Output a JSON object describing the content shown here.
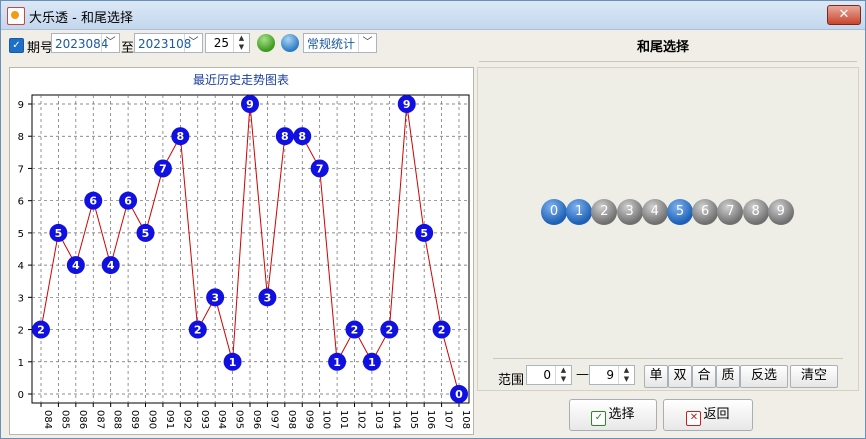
{
  "window": {
    "title": "大乐透 - 和尾选择",
    "close": "✕"
  },
  "toolbar": {
    "period_label": "期号",
    "from": "2023084",
    "to_label": "至",
    "to": "2023108",
    "count": "25",
    "stat_mode": "常规统计"
  },
  "right_panel": {
    "title": "和尾选择",
    "balls": [
      {
        "label": "0",
        "selected": true
      },
      {
        "label": "1",
        "selected": true
      },
      {
        "label": "2",
        "selected": false
      },
      {
        "label": "3",
        "selected": false
      },
      {
        "label": "4",
        "selected": false
      },
      {
        "label": "5",
        "selected": true
      },
      {
        "label": "6",
        "selected": false
      },
      {
        "label": "7",
        "selected": false
      },
      {
        "label": "8",
        "selected": false
      },
      {
        "label": "9",
        "selected": false
      }
    ],
    "range_label": "范围",
    "range_min": "0",
    "range_dash": "—",
    "range_max": "9",
    "filters": [
      "单",
      "双",
      "合",
      "质",
      "反选",
      "清空"
    ]
  },
  "actions": {
    "select": "选择",
    "back": "返回"
  },
  "chart_data": {
    "type": "line",
    "title": "最近历史走势图表",
    "categories": [
      "084",
      "085",
      "086",
      "087",
      "088",
      "089",
      "090",
      "091",
      "092",
      "093",
      "094",
      "095",
      "096",
      "097",
      "098",
      "099",
      "100",
      "101",
      "102",
      "103",
      "104",
      "105",
      "106",
      "107",
      "108"
    ],
    "values": [
      2,
      5,
      4,
      6,
      4,
      6,
      5,
      7,
      8,
      2,
      3,
      1,
      9,
      3,
      8,
      8,
      7,
      1,
      2,
      1,
      2,
      9,
      5,
      2,
      0
    ],
    "ylim": [
      0,
      9
    ],
    "yticks": [
      "0",
      "1",
      "2",
      "3",
      "4",
      "5",
      "6",
      "7",
      "8",
      "9"
    ],
    "grid": true,
    "line_color": "#d40000",
    "marker_color": "#1010e0"
  }
}
